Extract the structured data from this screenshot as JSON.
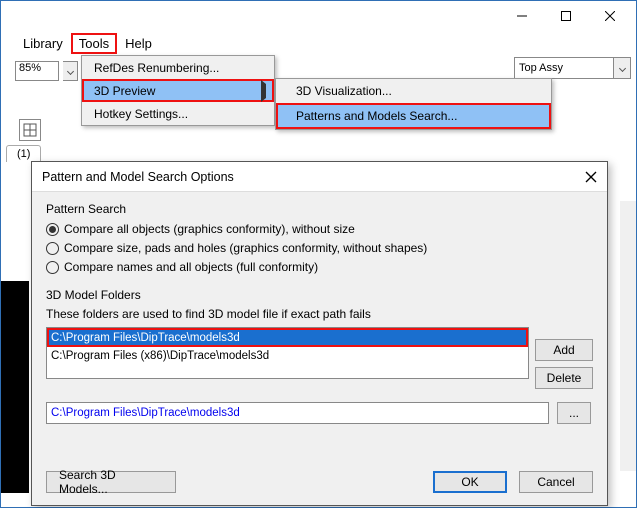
{
  "menubar": {
    "library": "Library",
    "tools": "Tools",
    "help": "Help"
  },
  "toolbar": {
    "zoom": "85%",
    "layer": "Top Assy"
  },
  "dropdown": {
    "refdes": "RefDes Renumbering...",
    "preview3d": "3D Preview",
    "hotkey": "Hotkey Settings..."
  },
  "submenu": {
    "viz3d": "3D Visualization...",
    "search": "Patterns and Models Search..."
  },
  "left_tab": "(1)",
  "dialog": {
    "title": "Pattern and Model Search Options",
    "pattern_search_label": "Pattern Search",
    "radio1": "Compare all objects (graphics conformity), without size",
    "radio2": "Compare size, pads and holes (graphics conformity, without shapes)",
    "radio3": "Compare names and all objects (full conformity)",
    "folders_label": "3D Model Folders",
    "folders_desc": "These folders are used to find 3D model file if exact path fails",
    "list": {
      "row1": "C:\\Program Files\\DipTrace\\models3d",
      "row2": "C:\\Program Files (x86)\\DipTrace\\models3d"
    },
    "path_input": "C:\\Program Files\\DipTrace\\models3d",
    "btn_add": "Add",
    "btn_delete": "Delete",
    "btn_browse": "...",
    "btn_search": "Search 3D Models...",
    "btn_ok": "OK",
    "btn_cancel": "Cancel"
  }
}
